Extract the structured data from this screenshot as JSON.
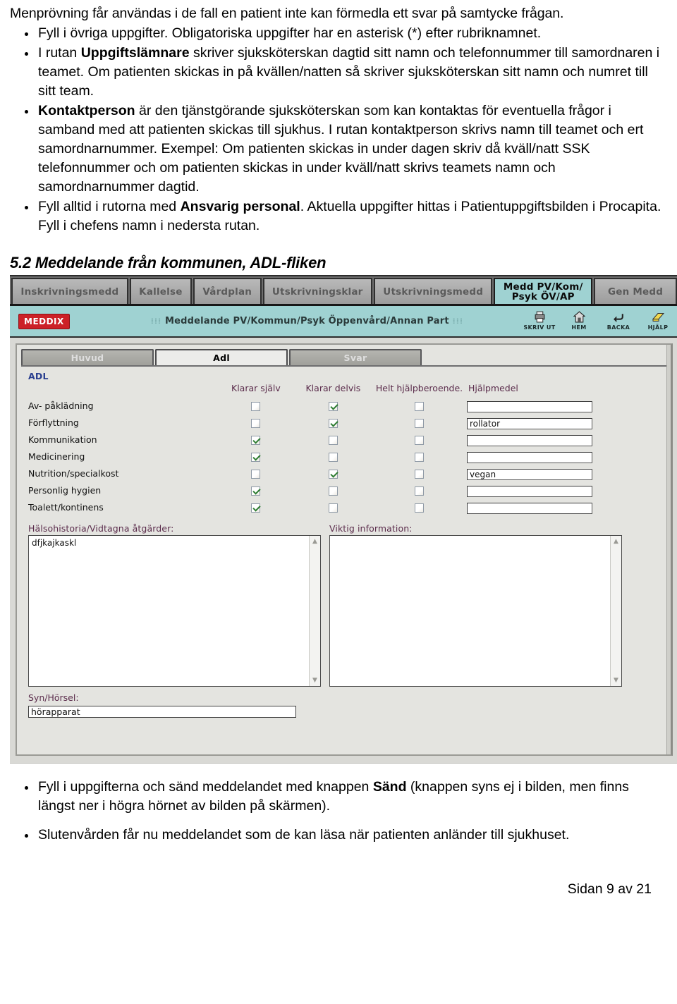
{
  "document": {
    "intro": "Menprövning får användas i de fall en patient inte kan förmedla ett svar på samtycke frågan.",
    "bullets": [
      {
        "parts": [
          {
            "t": "Fyll i övriga uppgifter.  Obligatoriska uppgifter har en asterisk (*) efter rubriknamnet.",
            "b": false
          }
        ]
      },
      {
        "parts": [
          {
            "t": "I rutan ",
            "b": false
          },
          {
            "t": "Uppgiftslämnare",
            "b": true
          },
          {
            "t": " skriver sjuksköterskan dagtid sitt namn och telefonnummer till samordnaren i teamet.  Om patienten skickas in på kvällen/natten så skriver sjuksköterskan sitt namn och numret till sitt team.",
            "b": false
          }
        ]
      },
      {
        "parts": [
          {
            "t": "Kontaktperson",
            "b": true
          },
          {
            "t": " är den tjänstgörande sjuksköterskan som kan kontaktas för eventuella frågor i samband med att patienten skickas till sjukhus.  I rutan kontaktperson skrivs namn till teamet och ert samordnarnummer.  Exempel: Om patienten skickas in under dagen skriv då kväll/natt SSK telefonnummer och om patienten skickas in under kväll/natt skrivs teamets namn och samordnarnummer dagtid.",
            "b": false
          }
        ]
      },
      {
        "parts": [
          {
            "t": "Fyll alltid i rutorna med ",
            "b": false
          },
          {
            "t": "Ansvarig personal",
            "b": true
          },
          {
            "t": ". Aktuella uppgifter hittas i Patientuppgiftsbilden i Procapita.  Fyll i chefens namn i nedersta rutan.",
            "b": false
          }
        ]
      }
    ],
    "section_heading": "5.2 Meddelande från kommunen, ADL-fliken",
    "bottom_bullets": [
      {
        "parts": [
          {
            "t": "Fyll i uppgifterna och sänd meddelandet med knappen ",
            "b": false
          },
          {
            "t": "Sänd",
            "b": true
          },
          {
            "t": " (knappen syns ej i bilden, men finns längst ner i högra hörnet av bilden på skärmen).",
            "b": false
          }
        ]
      },
      {
        "parts": [
          {
            "t": "Slutenvården får nu meddelandet som de kan läsa när patienten anländer till sjukhuset.",
            "b": false
          }
        ]
      }
    ],
    "page_footer": "Sidan 9 av 21"
  },
  "app": {
    "colors": {
      "accent_teal": "#9fd2d2",
      "tab_gray": "#a0a09b",
      "logo_red": "#cc2127",
      "panel_title_blue": "#2a3f8f",
      "field_label_purple": "#5b2d4c",
      "check_green": "#2e7d32"
    },
    "main_tabs": [
      {
        "label": "Inskrivningsmedd",
        "active": false
      },
      {
        "label": "Kallelse",
        "active": false
      },
      {
        "label": "Vårdplan",
        "active": false
      },
      {
        "label": "Utskrivningsklar",
        "active": false
      },
      {
        "label": "Utskrivningsmedd",
        "active": false
      },
      {
        "label": "Medd PV/Kom/\nPsyk ÖV/AP",
        "active": true
      },
      {
        "label": "Gen Medd",
        "active": false
      }
    ],
    "header": {
      "logo_text": "MEDDIX",
      "title": "Meddelande PV/Kommun/Psyk Öppenvård/Annan Part",
      "toolbar": [
        {
          "icon": "printer-icon",
          "label": "SKRIV UT"
        },
        {
          "icon": "home-icon",
          "label": "HEM"
        },
        {
          "icon": "back-arrow-icon",
          "label": "BACKA"
        },
        {
          "icon": "help-book-icon",
          "label": "HJÄLP"
        }
      ]
    },
    "sub_tabs": [
      {
        "label": "Huvud",
        "active": false
      },
      {
        "label": "Adl",
        "active": true
      },
      {
        "label": "Svar",
        "active": false
      }
    ],
    "adl": {
      "panel_title": "ADL",
      "columns": [
        "",
        "Klarar själv",
        "Klarar delvis",
        "Helt hjälpberoende.",
        "Hjälpmedel"
      ],
      "rows": [
        {
          "label": "Av- påklädning",
          "sjalv": false,
          "delvis": true,
          "helt": false,
          "aid": ""
        },
        {
          "label": "Förflyttning",
          "sjalv": false,
          "delvis": true,
          "helt": false,
          "aid": "rollator"
        },
        {
          "label": "Kommunikation",
          "sjalv": true,
          "delvis": false,
          "helt": false,
          "aid": ""
        },
        {
          "label": "Medicinering",
          "sjalv": true,
          "delvis": false,
          "helt": false,
          "aid": ""
        },
        {
          "label": "Nutrition/specialkost",
          "sjalv": false,
          "delvis": true,
          "helt": false,
          "aid": "vegan"
        },
        {
          "label": "Personlig hygien",
          "sjalv": true,
          "delvis": false,
          "helt": false,
          "aid": ""
        },
        {
          "label": "Toalett/kontinens",
          "sjalv": true,
          "delvis": false,
          "helt": false,
          "aid": ""
        }
      ],
      "textareas": [
        {
          "label": "Hälsohistoria/Vidtagna åtgärder:",
          "value": "dfjkajkaskl"
        },
        {
          "label": "Viktig information:",
          "value": ""
        }
      ],
      "syn_horsel": {
        "label": "Syn/Hörsel:",
        "value": "hörapparat"
      }
    }
  }
}
